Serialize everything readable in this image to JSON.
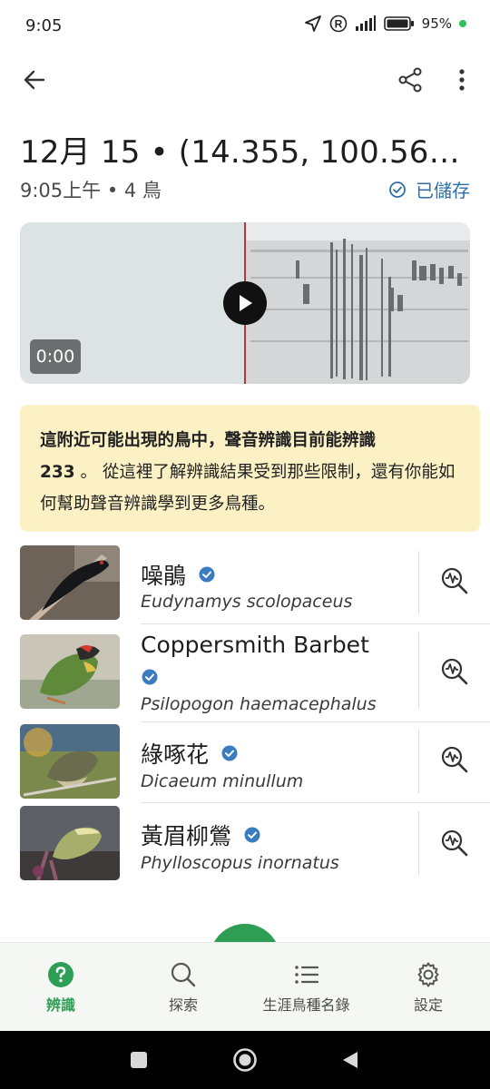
{
  "status_bar": {
    "time": "9:05",
    "battery": "95%",
    "icons": [
      "navigation-icon",
      "registered-icon",
      "signal-icon",
      "battery-icon"
    ]
  },
  "app_bar": {
    "icons": [
      "back-arrow-icon",
      "share-icon",
      "more-vert-icon"
    ]
  },
  "recording": {
    "title": "12月 15 • (14.355, 100.56…",
    "subtitle": "9:05上午 • 4 鳥",
    "saved_label": "已儲存"
  },
  "player": {
    "time": "0:00"
  },
  "notice": {
    "line1": "這附近可能出現的鳥中，聲音辨識目前能辨識",
    "count": "233",
    "sep": " 。 ",
    "link_text": "從這裡了解辨識結果受到那些限制，還有你能如何幫助聲音辨識學到更多鳥種。"
  },
  "species": [
    {
      "common": "噪鵑",
      "scientific": "Eudynamys scolopaceus",
      "verified": true
    },
    {
      "common": "Coppersmith Barbet",
      "scientific": "Psilopogon haemacephalus",
      "verified": true
    },
    {
      "common": "綠啄花",
      "scientific": "Dicaeum minullum",
      "verified": true
    },
    {
      "common": "黃眉柳鶯",
      "scientific": "Phylloscopus inornatus",
      "verified": true
    }
  ],
  "bottom_nav": {
    "items": [
      {
        "label": "辨識",
        "icon": "help-circle-icon",
        "active": true
      },
      {
        "label": "探索",
        "icon": "search-icon",
        "active": false
      },
      {
        "label": "生涯鳥種名錄",
        "icon": "list-icon",
        "active": false
      },
      {
        "label": "設定",
        "icon": "gear-icon",
        "active": false
      }
    ]
  },
  "colors": {
    "accent_green": "#2e9e54",
    "saved_blue": "#2f6fa8",
    "notice_bg": "#fbf1c4",
    "verified_blue": "#3b7bbf"
  }
}
